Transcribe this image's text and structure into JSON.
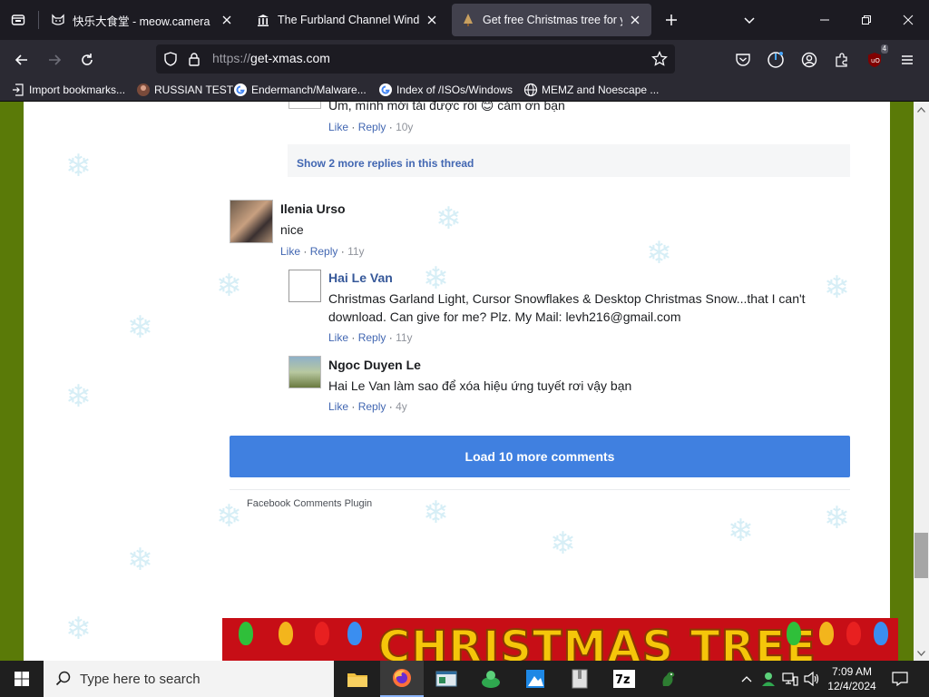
{
  "tabs": [
    {
      "title": "快乐大食堂 - meow.camera",
      "icon": "cat-icon",
      "active": false
    },
    {
      "title": "The Furbland Channel Windows",
      "icon": "museum-icon",
      "active": false
    },
    {
      "title": "Get free Christmas tree for your",
      "icon": "tree-icon",
      "active": true
    }
  ],
  "url": {
    "protocol": "https://",
    "host": "get-xmas.com"
  },
  "toolbar": {
    "extension_badge": "4"
  },
  "bookmarks": [
    {
      "label": "Import bookmarks...",
      "icon": "import-icon"
    },
    {
      "label": "RUSSIAN TEST",
      "icon": "user-favicon"
    },
    {
      "label": "Endermanch/Malware...",
      "icon": "google-icon"
    },
    {
      "label": "Index of /ISOs/Windows",
      "icon": "google-icon"
    },
    {
      "label": "MEMZ and Noescape ...",
      "icon": "globe-icon"
    }
  ],
  "comments": {
    "top_partial": {
      "text": "Um, mình mới tải được rồi 😊 cảm ơn bạn",
      "like": "Like",
      "reply": "Reply",
      "time": "10y"
    },
    "show_more": "Show 2 more replies in this thread",
    "ilenia": {
      "name": "Ilenia Urso",
      "text": "nice",
      "like": "Like",
      "reply": "Reply",
      "time": "11y"
    },
    "hai": {
      "name": "Hai Le Van",
      "text_line1": "Christmas Garland Light, Cursor Snowflakes & Desktop Christmas Snow...that I can't",
      "text_line2": "download. Can give for me? Plz. My Mail: levh216@gmail.com",
      "like": "Like",
      "reply": "Reply",
      "time": "11y"
    },
    "ngoc": {
      "name": "Ngoc Duyen Le",
      "text": "Hai Le Van làm sao để xóa hiệu ứng tuyết rơi vậy bạn",
      "like": "Like",
      "reply": "Reply",
      "time": "4y"
    },
    "load_more": "Load 10 more comments",
    "plugin": "Facebook Comments Plugin",
    "sep": "·"
  },
  "banner": {
    "text": "CHRISTMAS TREE"
  },
  "taskbar": {
    "search_placeholder": "Type here to search",
    "time": "7:09 AM",
    "date": "12/4/2024"
  },
  "colors": {
    "page_bg": "#5a7a08",
    "fb_blue": "#4267b2",
    "load_btn": "#4080e0"
  }
}
